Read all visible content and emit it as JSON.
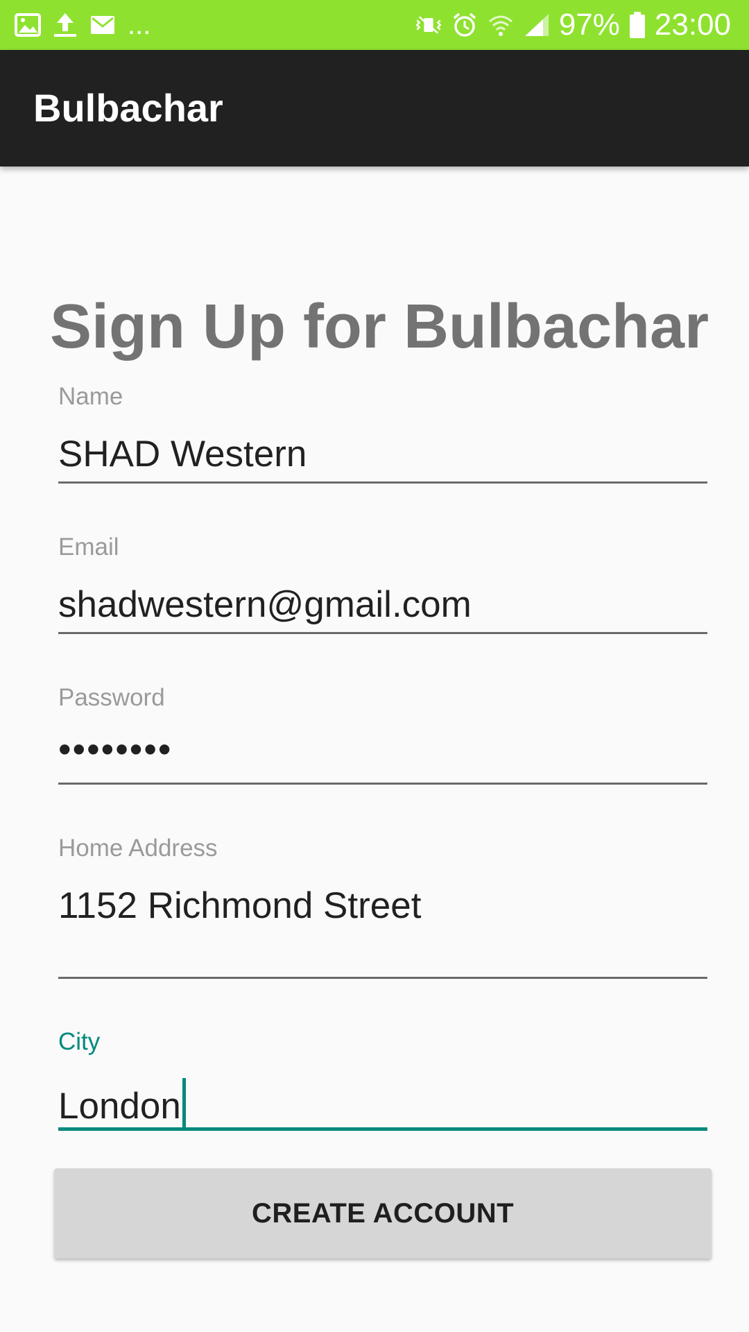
{
  "status_bar": {
    "battery_percent": "97%",
    "time": "23:00",
    "overflow": "...",
    "background_color": "#8ee22f",
    "left_icons": [
      "gallery-icon",
      "upload-icon",
      "mail-icon"
    ],
    "right_icons": [
      "vibrate-mute-icon",
      "alarm-icon",
      "wifi-icon",
      "signal-icon",
      "battery-icon"
    ]
  },
  "app_bar": {
    "title": "Bulbachar",
    "background_color": "#212121"
  },
  "form": {
    "heading": "Sign Up for Bulbachar",
    "fields": {
      "name": {
        "label": "Name",
        "value": "SHAD Western"
      },
      "email": {
        "label": "Email",
        "value": "shadwestern@gmail.com"
      },
      "password": {
        "label": "Password",
        "value": "••••••••"
      },
      "address": {
        "label": "Home Address",
        "value": "1152 Richmond Street"
      },
      "city": {
        "label": "City",
        "value": "London",
        "focused": true
      }
    },
    "accent_color": "#00897b",
    "submit_label": "CREATE ACCOUNT"
  }
}
